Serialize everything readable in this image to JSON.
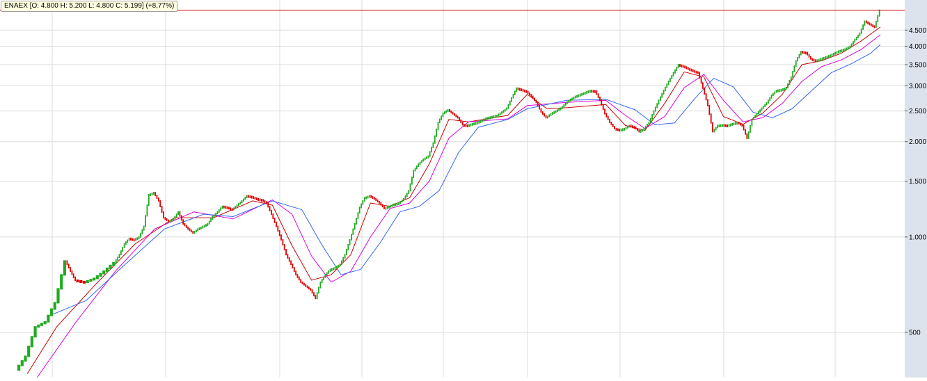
{
  "header": {
    "symbol": "ENAEX",
    "ohlc_text": "[O: 4.800  H: 5.200  L: 4.800  C: 5.199] (+8,77%)"
  },
  "colors": {
    "up": "#22aa22",
    "down": "#dd0000",
    "ma_fast": "#cc0000",
    "ma_mid": "#dd00dd",
    "ma_slow": "#3366ee",
    "last_price_line": "#cc0000",
    "grid": "#dcdcdc",
    "axis_bg": "#dde3ec"
  },
  "chart_data": {
    "type": "line",
    "scale": "log",
    "y_ticks": [
      {
        "value": 4500,
        "label": "4.500"
      },
      {
        "value": 4000,
        "label": "4.000"
      },
      {
        "value": 3500,
        "label": "3.500"
      },
      {
        "value": 3000,
        "label": "3.000"
      },
      {
        "value": 2500,
        "label": "2.500"
      },
      {
        "value": 2000,
        "label": "2.000"
      },
      {
        "value": 1500,
        "label": "1.500"
      },
      {
        "value": 1000,
        "label": "1.000"
      },
      {
        "value": 500,
        "label": "500"
      }
    ],
    "ylim": [
      360,
      5600
    ],
    "last_close": 5199,
    "grid": true,
    "close_series": [
      [
        0,
        380
      ],
      [
        10,
        420
      ],
      [
        20,
        520
      ],
      [
        30,
        540
      ],
      [
        40,
        620
      ],
      [
        50,
        840
      ],
      [
        55,
        780
      ],
      [
        60,
        730
      ],
      [
        70,
        720
      ],
      [
        80,
        740
      ],
      [
        90,
        780
      ],
      [
        100,
        830
      ],
      [
        105,
        880
      ],
      [
        110,
        950
      ],
      [
        115,
        990
      ],
      [
        120,
        980
      ],
      [
        125,
        1000
      ],
      [
        130,
        1080
      ],
      [
        135,
        1360
      ],
      [
        140,
        1380
      ],
      [
        145,
        1300
      ],
      [
        150,
        1150
      ],
      [
        155,
        1120
      ],
      [
        160,
        1140
      ],
      [
        165,
        1200
      ],
      [
        170,
        1100
      ],
      [
        175,
        1060
      ],
      [
        180,
        1030
      ],
      [
        185,
        1060
      ],
      [
        190,
        1080
      ],
      [
        195,
        1100
      ],
      [
        200,
        1160
      ],
      [
        205,
        1200
      ],
      [
        210,
        1250
      ],
      [
        215,
        1240
      ],
      [
        220,
        1220
      ],
      [
        225,
        1260
      ],
      [
        230,
        1300
      ],
      [
        235,
        1350
      ],
      [
        240,
        1340
      ],
      [
        245,
        1320
      ],
      [
        250,
        1310
      ],
      [
        255,
        1280
      ],
      [
        260,
        1180
      ],
      [
        265,
        1080
      ],
      [
        270,
        980
      ],
      [
        275,
        880
      ],
      [
        280,
        820
      ],
      [
        285,
        760
      ],
      [
        290,
        720
      ],
      [
        295,
        700
      ],
      [
        300,
        680
      ],
      [
        305,
        640
      ],
      [
        310,
        720
      ],
      [
        315,
        760
      ],
      [
        320,
        790
      ],
      [
        325,
        800
      ],
      [
        330,
        820
      ],
      [
        335,
        880
      ],
      [
        340,
        980
      ],
      [
        345,
        1100
      ],
      [
        350,
        1240
      ],
      [
        355,
        1330
      ],
      [
        360,
        1350
      ],
      [
        365,
        1320
      ],
      [
        370,
        1280
      ],
      [
        375,
        1230
      ],
      [
        380,
        1250
      ],
      [
        385,
        1270
      ],
      [
        390,
        1280
      ],
      [
        395,
        1320
      ],
      [
        400,
        1400
      ],
      [
        405,
        1620
      ],
      [
        410,
        1700
      ],
      [
        415,
        1760
      ],
      [
        420,
        1800
      ],
      [
        425,
        1980
      ],
      [
        430,
        2300
      ],
      [
        435,
        2460
      ],
      [
        440,
        2520
      ],
      [
        445,
        2450
      ],
      [
        450,
        2380
      ],
      [
        455,
        2260
      ],
      [
        460,
        2250
      ],
      [
        465,
        2280
      ],
      [
        470,
        2300
      ],
      [
        475,
        2340
      ],
      [
        480,
        2380
      ],
      [
        485,
        2400
      ],
      [
        490,
        2420
      ],
      [
        495,
        2480
      ],
      [
        500,
        2550
      ],
      [
        505,
        2750
      ],
      [
        510,
        2950
      ],
      [
        515,
        2920
      ],
      [
        520,
        2880
      ],
      [
        525,
        2780
      ],
      [
        530,
        2660
      ],
      [
        535,
        2480
      ],
      [
        540,
        2380
      ],
      [
        545,
        2450
      ],
      [
        550,
        2500
      ],
      [
        555,
        2550
      ],
      [
        560,
        2640
      ],
      [
        565,
        2720
      ],
      [
        570,
        2780
      ],
      [
        575,
        2820
      ],
      [
        580,
        2860
      ],
      [
        585,
        2900
      ],
      [
        590,
        2890
      ],
      [
        595,
        2700
      ],
      [
        600,
        2450
      ],
      [
        605,
        2300
      ],
      [
        610,
        2200
      ],
      [
        615,
        2180
      ],
      [
        620,
        2200
      ],
      [
        625,
        2250
      ],
      [
        630,
        2220
      ],
      [
        635,
        2150
      ],
      [
        640,
        2200
      ],
      [
        645,
        2300
      ],
      [
        650,
        2500
      ],
      [
        655,
        2700
      ],
      [
        660,
        2900
      ],
      [
        665,
        3100
      ],
      [
        670,
        3300
      ],
      [
        675,
        3500
      ],
      [
        680,
        3460
      ],
      [
        685,
        3400
      ],
      [
        690,
        3350
      ],
      [
        695,
        3300
      ],
      [
        700,
        2950
      ],
      [
        705,
        2600
      ],
      [
        710,
        2150
      ],
      [
        715,
        2250
      ],
      [
        720,
        2260
      ],
      [
        725,
        2250
      ],
      [
        730,
        2280
      ],
      [
        735,
        2300
      ],
      [
        740,
        2250
      ],
      [
        745,
        2050
      ],
      [
        750,
        2350
      ],
      [
        755,
        2450
      ],
      [
        760,
        2550
      ],
      [
        765,
        2650
      ],
      [
        770,
        2800
      ],
      [
        775,
        2900
      ],
      [
        780,
        2920
      ],
      [
        785,
        2960
      ],
      [
        790,
        3200
      ],
      [
        795,
        3600
      ],
      [
        800,
        3850
      ],
      [
        805,
        3820
      ],
      [
        810,
        3650
      ],
      [
        815,
        3600
      ],
      [
        820,
        3650
      ],
      [
        825,
        3700
      ],
      [
        830,
        3750
      ],
      [
        835,
        3820
      ],
      [
        840,
        3880
      ],
      [
        845,
        3920
      ],
      [
        850,
        4000
      ],
      [
        855,
        4200
      ],
      [
        860,
        4400
      ],
      [
        865,
        4800
      ],
      [
        870,
        4700
      ],
      [
        875,
        4600
      ],
      [
        880,
        5199
      ]
    ],
    "ma_series": [
      {
        "key": "ma_fast",
        "points": [
          [
            10,
            370
          ],
          [
            40,
            520
          ],
          [
            80,
            710
          ],
          [
            120,
            950
          ],
          [
            160,
            1150
          ],
          [
            200,
            1150
          ],
          [
            240,
            1300
          ],
          [
            260,
            1260
          ],
          [
            280,
            940
          ],
          [
            300,
            730
          ],
          [
            320,
            760
          ],
          [
            340,
            880
          ],
          [
            360,
            1280
          ],
          [
            380,
            1250
          ],
          [
            400,
            1330
          ],
          [
            420,
            1700
          ],
          [
            440,
            2350
          ],
          [
            460,
            2310
          ],
          [
            500,
            2420
          ],
          [
            520,
            2820
          ],
          [
            540,
            2540
          ],
          [
            560,
            2560
          ],
          [
            600,
            2620
          ],
          [
            620,
            2250
          ],
          [
            640,
            2170
          ],
          [
            660,
            2640
          ],
          [
            680,
            3320
          ],
          [
            700,
            3200
          ],
          [
            720,
            2400
          ],
          [
            740,
            2270
          ],
          [
            760,
            2460
          ],
          [
            780,
            2820
          ],
          [
            800,
            3500
          ],
          [
            820,
            3600
          ],
          [
            840,
            3800
          ],
          [
            860,
            4150
          ],
          [
            880,
            4600
          ]
        ]
      },
      {
        "key": "ma_mid",
        "points": [
          [
            20,
            360
          ],
          [
            60,
            540
          ],
          [
            100,
            780
          ],
          [
            140,
            1060
          ],
          [
            180,
            1200
          ],
          [
            220,
            1140
          ],
          [
            260,
            1310
          ],
          [
            280,
            1180
          ],
          [
            300,
            870
          ],
          [
            320,
            720
          ],
          [
            340,
            780
          ],
          [
            360,
            1000
          ],
          [
            380,
            1230
          ],
          [
            400,
            1280
          ],
          [
            420,
            1500
          ],
          [
            440,
            2050
          ],
          [
            460,
            2310
          ],
          [
            500,
            2360
          ],
          [
            520,
            2600
          ],
          [
            560,
            2660
          ],
          [
            600,
            2700
          ],
          [
            620,
            2420
          ],
          [
            640,
            2200
          ],
          [
            660,
            2400
          ],
          [
            680,
            2960
          ],
          [
            700,
            3260
          ],
          [
            720,
            2700
          ],
          [
            740,
            2310
          ],
          [
            760,
            2380
          ],
          [
            780,
            2640
          ],
          [
            800,
            3100
          ],
          [
            820,
            3450
          ],
          [
            840,
            3620
          ],
          [
            860,
            3900
          ],
          [
            880,
            4350
          ]
        ]
      },
      {
        "key": "ma_slow",
        "points": [
          [
            30,
            560
          ],
          [
            70,
            630
          ],
          [
            110,
            820
          ],
          [
            150,
            1060
          ],
          [
            190,
            1180
          ],
          [
            220,
            1160
          ],
          [
            260,
            1300
          ],
          [
            290,
            1220
          ],
          [
            310,
            950
          ],
          [
            330,
            760
          ],
          [
            350,
            790
          ],
          [
            370,
            960
          ],
          [
            390,
            1200
          ],
          [
            410,
            1250
          ],
          [
            430,
            1400
          ],
          [
            450,
            1850
          ],
          [
            470,
            2220
          ],
          [
            500,
            2350
          ],
          [
            520,
            2540
          ],
          [
            560,
            2700
          ],
          [
            600,
            2720
          ],
          [
            630,
            2520
          ],
          [
            650,
            2260
          ],
          [
            670,
            2290
          ],
          [
            690,
            2720
          ],
          [
            710,
            3170
          ],
          [
            730,
            2980
          ],
          [
            750,
            2480
          ],
          [
            770,
            2380
          ],
          [
            790,
            2540
          ],
          [
            810,
            2900
          ],
          [
            830,
            3300
          ],
          [
            850,
            3520
          ],
          [
            870,
            3800
          ],
          [
            880,
            4050
          ]
        ]
      }
    ]
  }
}
